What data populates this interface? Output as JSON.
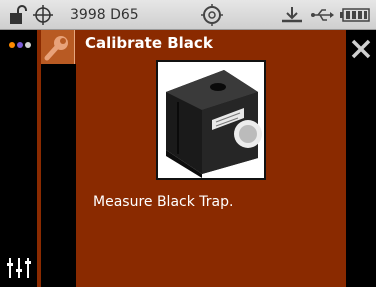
{
  "statusbar": {
    "info_text": "3998 D65",
    "icons": [
      "unlock-icon",
      "crosshair-icon",
      "target-icon",
      "tray-icon",
      "usb-icon",
      "battery-icon"
    ]
  },
  "left_rail": {
    "dot_colors": [
      "#ff8a00",
      "#7a5bd6",
      "#d0d0d0"
    ],
    "settings_icon": "sliders-icon"
  },
  "header": {
    "title": "Calibrate Black",
    "icon": "wrench-icon"
  },
  "main": {
    "image": "black-trap-photo",
    "message": "Measure Black Trap."
  },
  "close": {
    "icon": "close-icon"
  },
  "colors": {
    "panel": "#8a2a00",
    "header_icon_bg": "#b85a23",
    "statusbar": "#d9d9d9",
    "rail": "#000000",
    "text": "#ffffff"
  }
}
